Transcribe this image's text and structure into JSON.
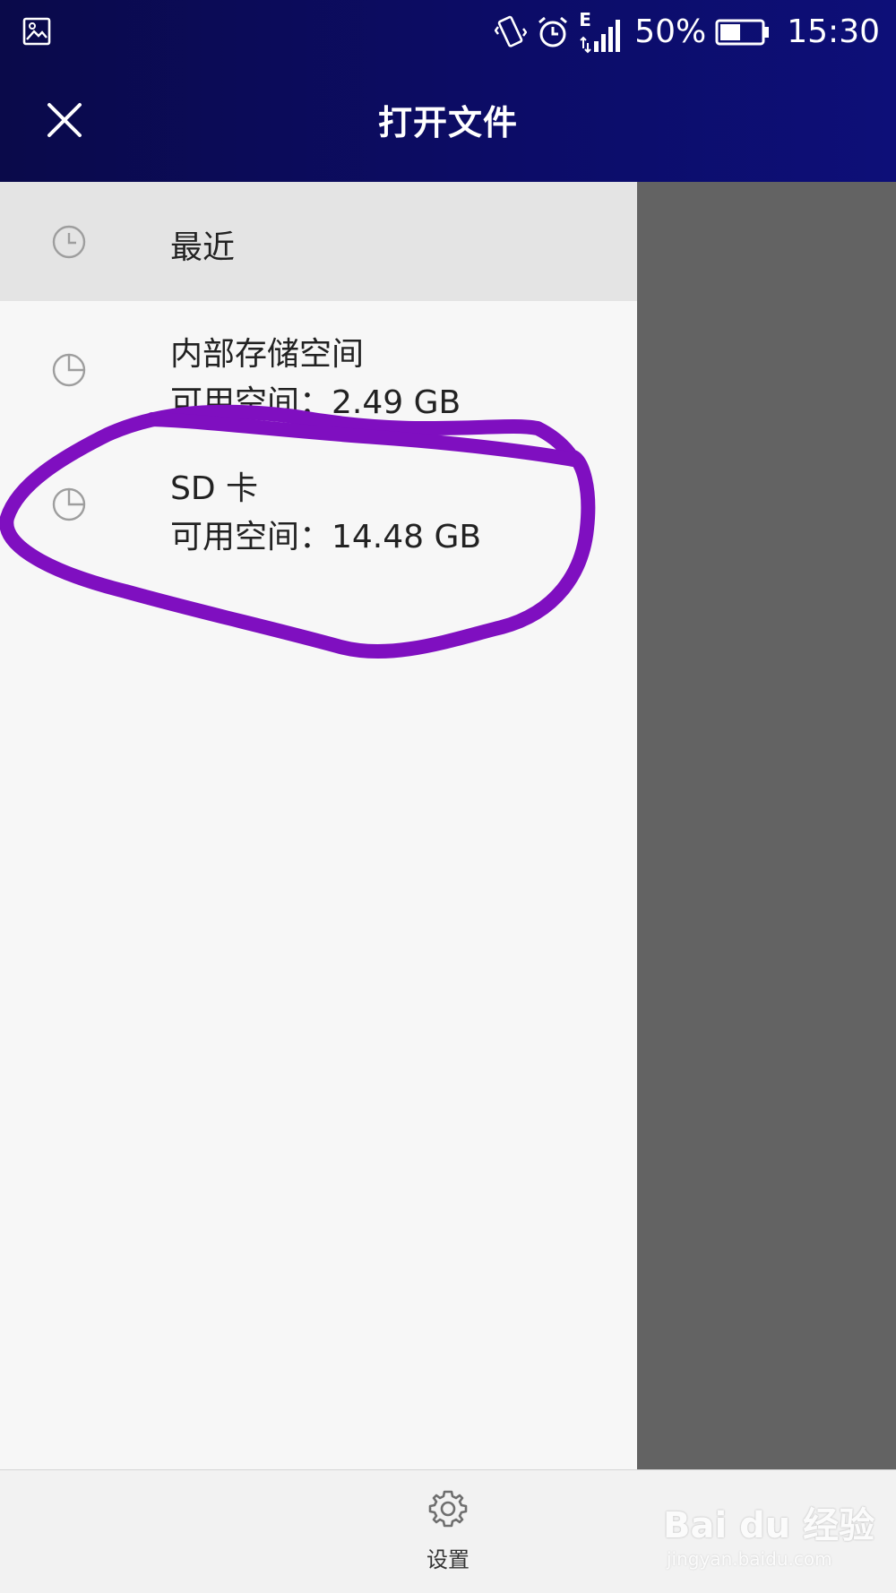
{
  "status_bar": {
    "battery_percent": "50%",
    "time": "15:30",
    "network_label": "E",
    "icons": [
      "gallery-icon",
      "vibrate-icon",
      "alarm-icon",
      "signal-icon",
      "battery-icon"
    ],
    "battery_level": 0.5
  },
  "title_bar": {
    "title": "打开文件",
    "close_icon": "close-icon"
  },
  "drawer": {
    "items": [
      {
        "label": "最近",
        "icon": "clock-icon",
        "selected": true
      },
      {
        "label": "内部存储空间",
        "sub": "可用空间：2.49 GB",
        "icon": "storage-pie-icon",
        "selected": false
      },
      {
        "label": "SD 卡",
        "sub": "可用空间：14.48 GB",
        "icon": "storage-pie-icon",
        "selected": false
      }
    ]
  },
  "bottom_bar": {
    "settings_label": "设置",
    "settings_icon": "gear-icon"
  },
  "watermark": {
    "brand": "Bai du 经验",
    "url": "jingyan.baidu.com"
  },
  "colors": {
    "header_start": "#0a0a4a",
    "header_end": "#0d0f78",
    "drawer_bg": "#f7f7f7",
    "selected_bg": "#e4e4e4",
    "scrim": "#636363",
    "annotation": "#7f0fc0"
  }
}
